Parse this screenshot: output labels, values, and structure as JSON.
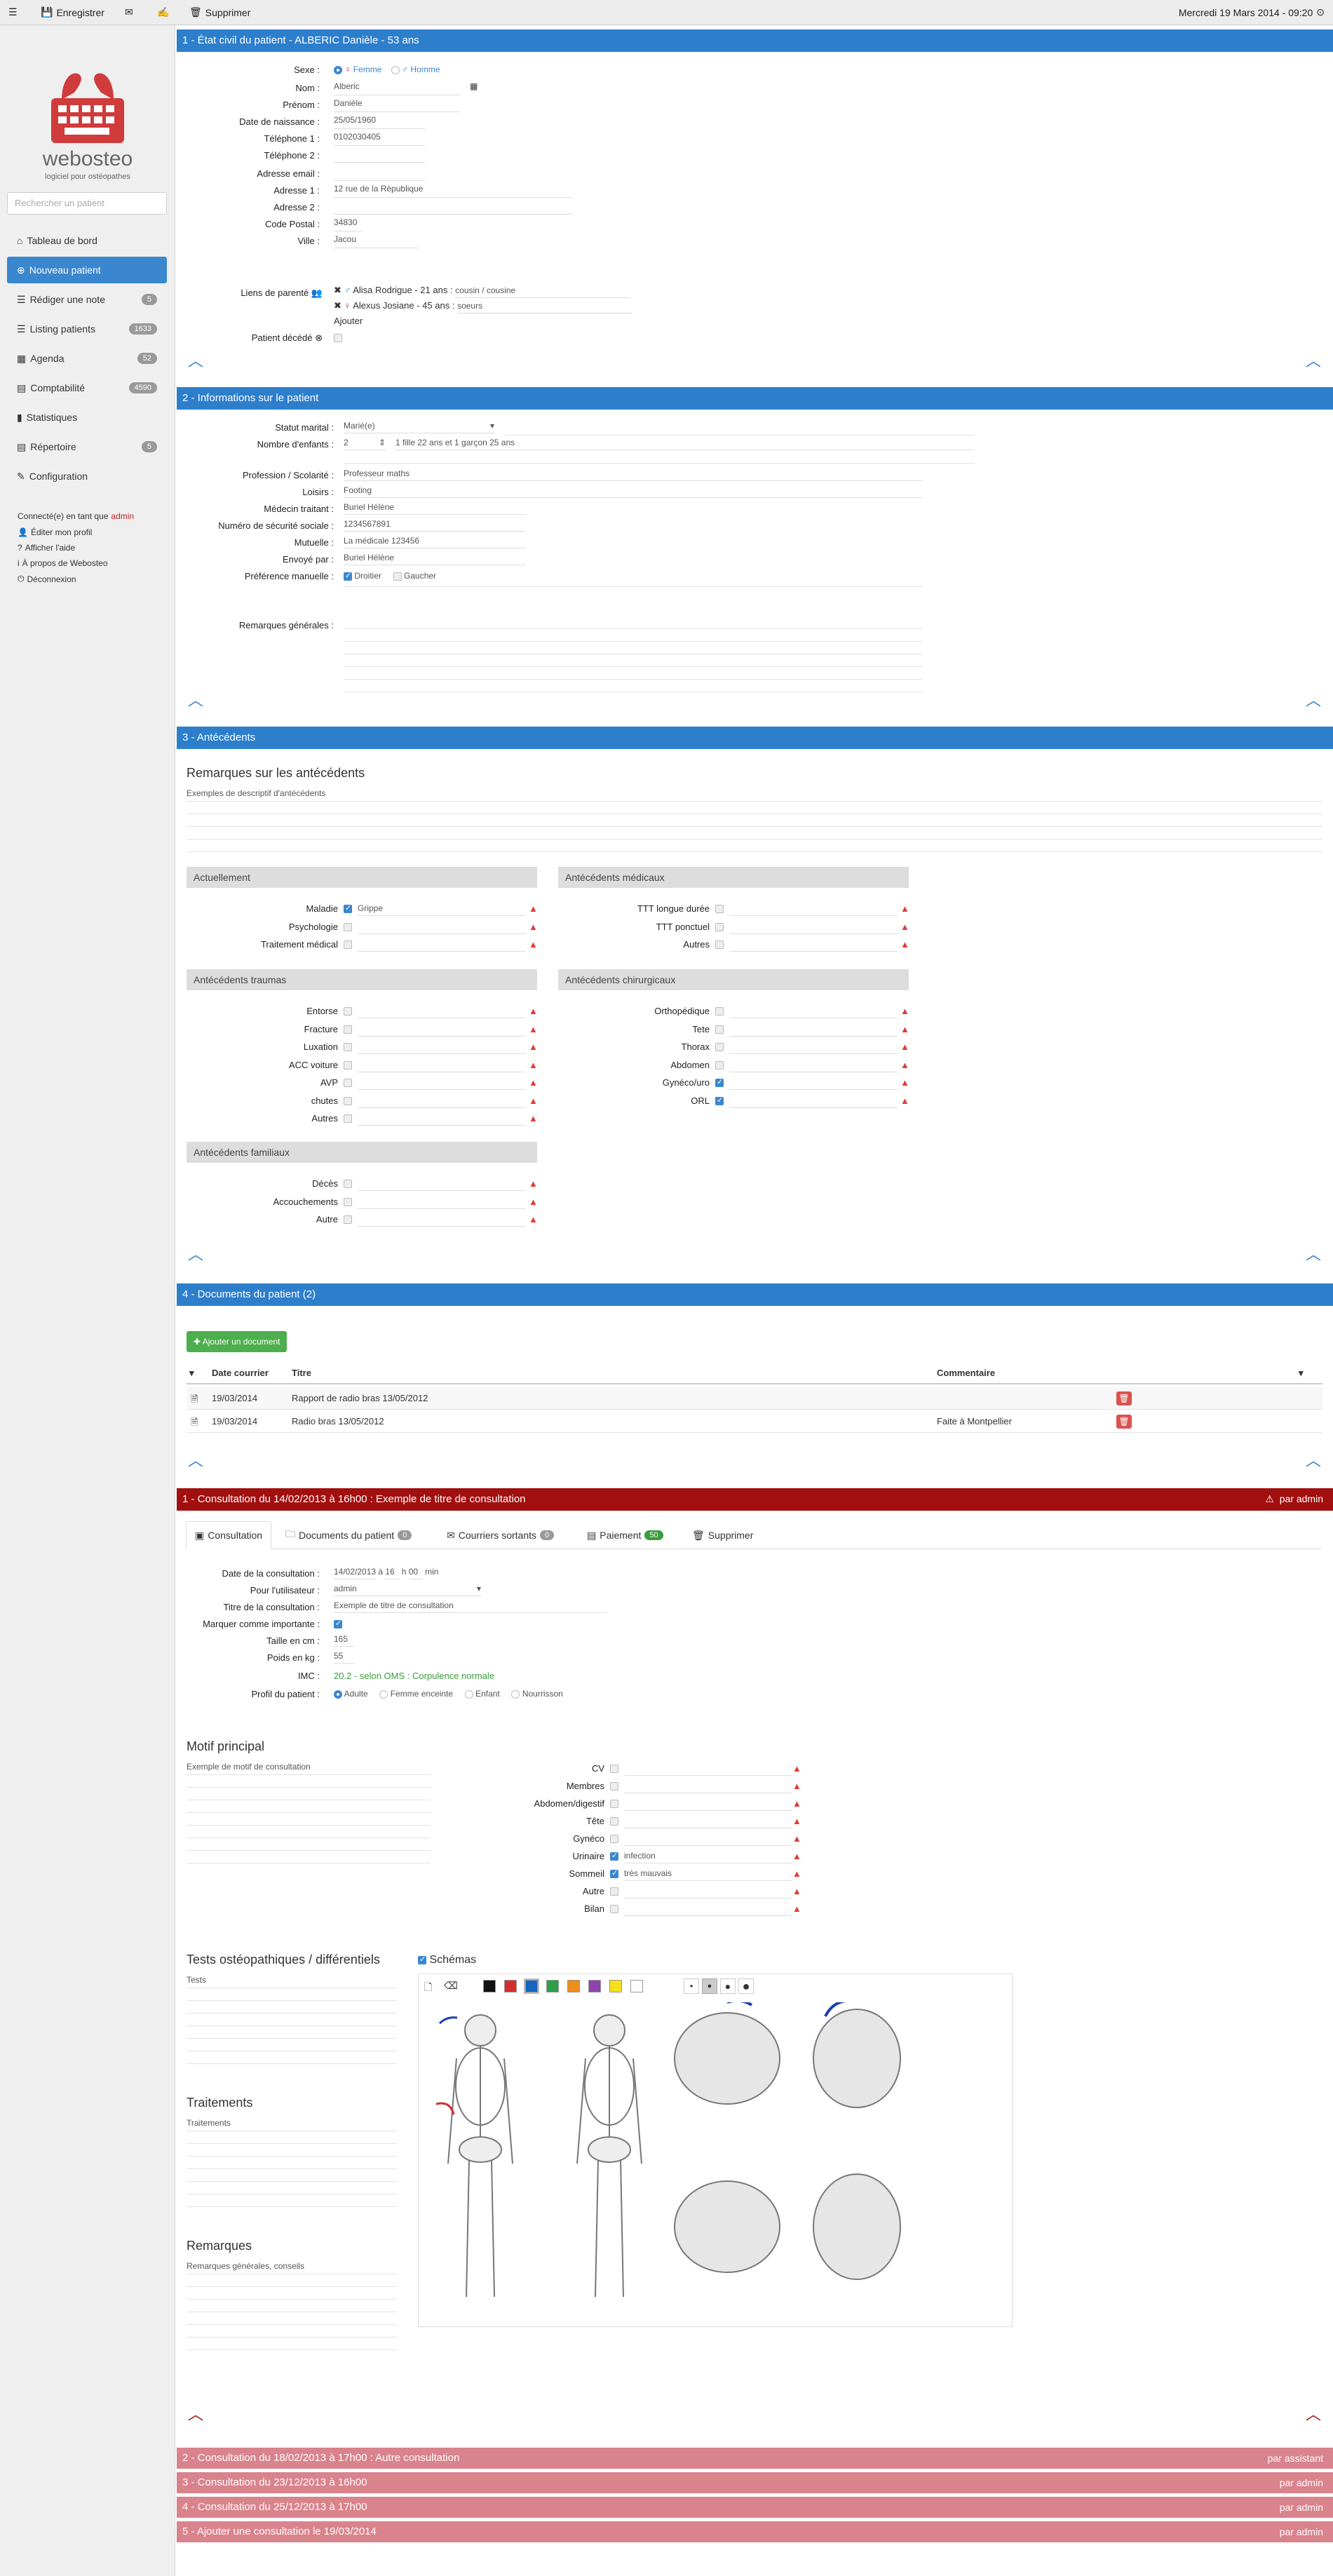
{
  "topbar": {
    "save": "Enregistrer",
    "delete": "Supprimer",
    "datetime": "Mercredi 19 Mars 2014 - 09:20"
  },
  "sidebar": {
    "logo_name": "webosteo",
    "logo_tag": "logiciel pour ostéopathes",
    "search_placeholder": "Rechercher un patient",
    "items": [
      {
        "label": "Tableau de bord",
        "badge": ""
      },
      {
        "label": "Nouveau patient",
        "badge": ""
      },
      {
        "label": "Rédiger une note",
        "badge": "5"
      },
      {
        "label": "Listing patients",
        "badge": "1633"
      },
      {
        "label": "Agenda",
        "badge": "52"
      },
      {
        "label": "Comptabilité",
        "badge": "4590"
      },
      {
        "label": "Statistiques",
        "badge": ""
      },
      {
        "label": "Répertoire",
        "badge": "5"
      },
      {
        "label": "Configuration",
        "badge": ""
      }
    ],
    "connected_as": "Connecté(e) en tant que",
    "user": "admin",
    "links": [
      "Éditer mon profil",
      "Afficher l'aide",
      "À propos de Webosteo",
      "Déconnexion"
    ]
  },
  "s1": {
    "title": "1 - État civil du patient - ALBERIC Danièle - 53 ans",
    "labels": [
      "Sexe :",
      "Nom :",
      "Prénom :",
      "Date de naissance :",
      "Téléphone 1 :",
      "Téléphone 2 :",
      "Adresse email :",
      "Adresse 1 :",
      "Adresse 2 :",
      "Code Postal :",
      "Ville :"
    ],
    "sex_f": "Femme",
    "sex_m": "Homme",
    "values": [
      "",
      "Alberic",
      "Danièle",
      "25/05/1960",
      "0102030405",
      "",
      "",
      "12 rue de la République",
      "",
      "34830",
      "Jacou"
    ],
    "relations_label": "Liens de parenté",
    "relations": [
      {
        "name": "Alisa Rodrigue - 21 ans",
        "rel": "cousin / cousine"
      },
      {
        "name": "Alexus Josiane - 45 ans",
        "rel": "soeurs"
      }
    ],
    "add": "Ajouter",
    "deceased": "Patient décédé"
  },
  "s2": {
    "title": "2 - Informations sur le patient",
    "labels": [
      "Statut marital :",
      "Nombre d'enfants :",
      "Profession / Scolarité :",
      "Loisirs :",
      "Médecin traitant :",
      "Numéro de sécurité sociale :",
      "Mutuelle :",
      "Envoyé par :",
      "Préférence manuelle :",
      "Remarques générales :"
    ],
    "marital": "Marié(e)",
    "children": "2",
    "children_note": "1 fille 22 ans et 1 garçon 25 ans",
    "profession": "Professeur maths",
    "loisirs": "Footing",
    "medecin": "Buriel Hélène",
    "secu": "1234567891",
    "mutuelle": "La médicale 123456",
    "envoye": "Buriel Hélène",
    "droitier": "Droitier",
    "gaucher": "Gaucher"
  },
  "s3": {
    "title": "3 - Antécédents",
    "remarks_title": "Remarques sur les antécédents",
    "remarks_val": "Exemples de descriptif d'antécédents",
    "groups": {
      "actuellement": {
        "title": "Actuellement",
        "items": [
          {
            "l": "Maladie",
            "v": "Grippe",
            "on": true
          },
          {
            "l": "Psychologie",
            "v": "",
            "on": false
          },
          {
            "l": "Traitement médical",
            "v": "",
            "on": false
          }
        ]
      },
      "medicaux": {
        "title": "Antécédents médicaux",
        "items": [
          {
            "l": "TTT longue durée",
            "v": "",
            "on": false
          },
          {
            "l": "TTT ponctuel",
            "v": "",
            "on": false
          },
          {
            "l": "Autres",
            "v": "",
            "on": false
          }
        ]
      },
      "traumas": {
        "title": "Antécédents traumas",
        "items": [
          {
            "l": "Entorse",
            "on": false
          },
          {
            "l": "Fracture",
            "on": false
          },
          {
            "l": "Luxation",
            "on": false
          },
          {
            "l": "ACC voiture",
            "on": false
          },
          {
            "l": "AVP",
            "on": false
          },
          {
            "l": "chutes",
            "on": false
          },
          {
            "l": "Autres",
            "on": false
          }
        ]
      },
      "chirurgicaux": {
        "title": "Antécédents chirurgicaux",
        "items": [
          {
            "l": "Orthopédique",
            "on": false
          },
          {
            "l": "Tete",
            "on": false
          },
          {
            "l": "Thorax",
            "on": false
          },
          {
            "l": "Abdomen",
            "on": false
          },
          {
            "l": "Gynéco/uro",
            "on": true
          },
          {
            "l": "ORL",
            "on": true
          }
        ]
      },
      "familiaux": {
        "title": "Antécédents familiaux",
        "items": [
          {
            "l": "Décès",
            "on": false
          },
          {
            "l": "Accouchements",
            "on": false
          },
          {
            "l": "Autre",
            "on": false
          }
        ]
      }
    }
  },
  "s4": {
    "title": "4 - Documents du patient (2)",
    "add_btn": "Ajouter un document",
    "cols": [
      "Date courrier",
      "Titre",
      "Commentaire"
    ],
    "rows": [
      {
        "date": "19/03/2014",
        "title": "Rapport de radio bras 13/05/2012",
        "comment": ""
      },
      {
        "date": "19/03/2014",
        "title": "Radio bras 13/05/2012",
        "comment": "Faite à Montpellier"
      }
    ]
  },
  "c1": {
    "title": "1 - Consultation du 14/02/2013 à 16h00 : Exemple de titre de consultation",
    "by": "par admin",
    "tabs": [
      {
        "l": "Consultation",
        "b": ""
      },
      {
        "l": "Documents du patient",
        "b": "0"
      },
      {
        "l": "Courriers sortants",
        "b": "0"
      },
      {
        "l": "Paiement",
        "b": "50"
      },
      {
        "l": "Supprimer",
        "b": ""
      }
    ],
    "labels": [
      "Date de la consultation :",
      "Pour l'utilisateur :",
      "Titre de la consultation :",
      "Marquer comme importante :",
      "Taille en cm :",
      "Poids en kg :",
      "IMC :",
      "Profil du patient :"
    ],
    "date": "14/02/2013",
    "a": "à",
    "hour": "16",
    "h": "h",
    "min": "00",
    "min_l": "min",
    "user": "admin",
    "ctitle": "Exemple de titre de consultation",
    "taille": "165",
    "poids": "55",
    "imc": "20.2 - selon OMS : Corpulence normale",
    "profils": [
      "Adulte",
      "Femme enceinte",
      "Enfant",
      "Nourrisson"
    ],
    "motif_title": "Motif principal",
    "motif_val": "Exemple de motif de consultation",
    "systems": [
      {
        "l": "CV",
        "v": "",
        "on": false
      },
      {
        "l": "Membres",
        "v": "",
        "on": false
      },
      {
        "l": "Abdomen/digestif",
        "v": "",
        "on": false
      },
      {
        "l": "Tête",
        "v": "",
        "on": false
      },
      {
        "l": "Gynéco",
        "v": "",
        "on": false
      },
      {
        "l": "Urinaire",
        "v": "infection",
        "on": true
      },
      {
        "l": "Sommeil",
        "v": "très mauvais",
        "on": true
      },
      {
        "l": "Autre",
        "v": "",
        "on": false
      },
      {
        "l": "Bilan",
        "v": "",
        "on": false
      }
    ],
    "tests_title": "Tests ostéopathiques / différentiels",
    "tests_val": "Tests",
    "traitements_title": "Traitements",
    "traitements_val": "Traitements",
    "remarques_title": "Remarques",
    "remarques_val": "Remarques générales, conseils",
    "schemas": "Schémas",
    "palette": [
      "#111111",
      "#d32f2f",
      "#1565c0",
      "#2e9e4a",
      "#f08c1a",
      "#8e44ad",
      "#f4e11a",
      "#ffffff"
    ]
  },
  "other": [
    {
      "t": "2 - Consultation du 18/02/2013 à 17h00 : Autre consultation",
      "by": "par assistant"
    },
    {
      "t": "3 - Consultation du 23/12/2013 à 16h00",
      "by": "par admin"
    },
    {
      "t": "4 - Consultation du 25/12/2013 à 17h00",
      "by": "par admin"
    },
    {
      "t": "5 - Ajouter une consultation le 19/03/2014",
      "by": "par admin"
    }
  ]
}
